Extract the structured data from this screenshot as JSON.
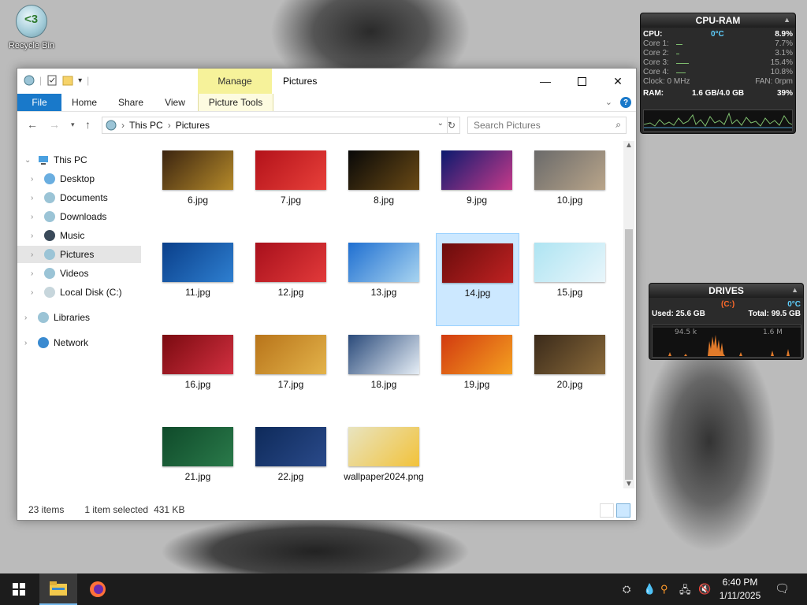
{
  "desktop": {
    "recycle_bin_label": "Recycle Bin"
  },
  "window": {
    "title": "Pictures",
    "manage_tab": "Manage",
    "ribbon_tabs": [
      "File",
      "Home",
      "Share",
      "View",
      "Picture Tools"
    ],
    "help_label": "?",
    "address": {
      "segments": [
        "This PC",
        "Pictures"
      ]
    },
    "search_placeholder": "Search Pictures",
    "nav_items": [
      {
        "label": "This PC"
      },
      {
        "label": "Desktop"
      },
      {
        "label": "Documents"
      },
      {
        "label": "Downloads"
      },
      {
        "label": "Music"
      },
      {
        "label": "Pictures"
      },
      {
        "label": "Videos"
      },
      {
        "label": "Local Disk (C:)"
      },
      {
        "label": "Libraries"
      },
      {
        "label": "Network"
      }
    ],
    "files": [
      {
        "name": "6.jpg",
        "c1": "#3b2410",
        "c2": "#b58a2a"
      },
      {
        "name": "7.jpg",
        "c1": "#b3121a",
        "c2": "#e8403a"
      },
      {
        "name": "8.jpg",
        "c1": "#080808",
        "c2": "#6a4a15"
      },
      {
        "name": "9.jpg",
        "c1": "#0b1a6e",
        "c2": "#c63a8a"
      },
      {
        "name": "10.jpg",
        "c1": "#6a6a6a",
        "c2": "#b9a58a"
      },
      {
        "name": "11.jpg",
        "c1": "#0a3f8a",
        "c2": "#2e7fd0"
      },
      {
        "name": "12.jpg",
        "c1": "#a8101c",
        "c2": "#e23a3a"
      },
      {
        "name": "13.jpg",
        "c1": "#1f6fd1",
        "c2": "#a8d4f0"
      },
      {
        "name": "14.jpg",
        "c1": "#6a0c0c",
        "c2": "#c02222"
      },
      {
        "name": "15.jpg",
        "c1": "#aee4f2",
        "c2": "#e9f6fb"
      },
      {
        "name": "16.jpg",
        "c1": "#7a0a10",
        "c2": "#d23040"
      },
      {
        "name": "17.jpg",
        "c1": "#b8741a",
        "c2": "#e3b34a"
      },
      {
        "name": "18.jpg",
        "c1": "#2a4a7a",
        "c2": "#e6eef6"
      },
      {
        "name": "19.jpg",
        "c1": "#d23a10",
        "c2": "#f4a020"
      },
      {
        "name": "20.jpg",
        "c1": "#3a2a1a",
        "c2": "#8a6a3a"
      },
      {
        "name": "21.jpg",
        "c1": "#0f4a2a",
        "c2": "#2a7a4a"
      },
      {
        "name": "22.jpg",
        "c1": "#0e2a5a",
        "c2": "#2a4a8a"
      },
      {
        "name": "wallpaper2024.png",
        "c1": "#e8e4c0",
        "c2": "#f2c23a"
      }
    ],
    "selected_file": "14.jpg",
    "status": {
      "items": "23 items",
      "selected": "1 item selected",
      "size": "431 KB"
    }
  },
  "cpu_gadget": {
    "title": "CPU-RAM",
    "cpu_label": "CPU:",
    "temp": "0°C",
    "cpu_pct": "8.9%",
    "cores": [
      {
        "label": "Core 1:",
        "value": "7.7%"
      },
      {
        "label": "Core 2:",
        "value": "3.1%"
      },
      {
        "label": "Core 3:",
        "value": "15.4%"
      },
      {
        "label": "Core 4:",
        "value": "10.8%"
      }
    ],
    "clock_label": "Clock: 0 MHz",
    "fan_label": "FAN: 0rpm",
    "ram_label": "RAM:",
    "ram_value": "1.6 GB/4.0 GB",
    "ram_pct": "39%"
  },
  "drives_gadget": {
    "title": "DRIVES",
    "drive": "(C:)",
    "temp": "0°C",
    "used": "Used: 25.6 GB",
    "total": "Total: 99.5 GB",
    "read": "94.5 k",
    "write": "1.6 M"
  },
  "taskbar": {
    "time": "6:40 PM",
    "date": "1/11/2025"
  },
  "colors": {
    "accent": "#1979ca",
    "selection": "#cce8ff",
    "manage_tab": "#f6f29a",
    "gadget_bg": "#2b2b2b",
    "graph_green": "#7fbf6f",
    "graph_orange": "#e07a2a"
  }
}
